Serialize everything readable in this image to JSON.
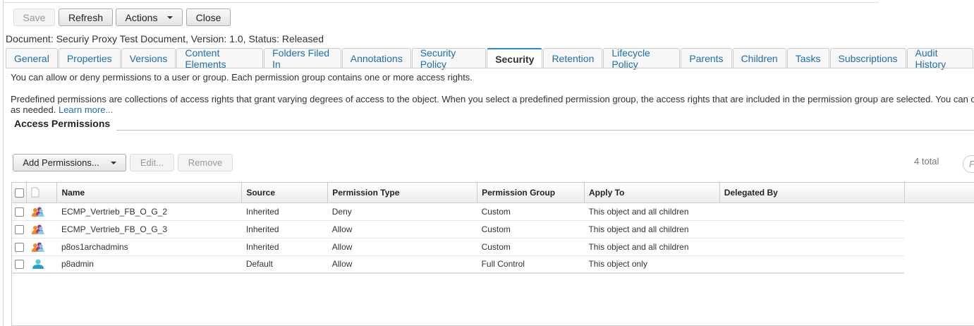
{
  "toolbar": {
    "save": "Save",
    "refresh": "Refresh",
    "actions": "Actions",
    "close": "Close"
  },
  "document_info": "Document: Securiy Proxy Test Document, Version: 1.0, Status: Released",
  "tabs": [
    "General",
    "Properties",
    "Versions",
    "Content Elements",
    "Folders Filed In",
    "Annotations",
    "Security Policy",
    "Security",
    "Retention",
    "Lifecycle Policy",
    "Parents",
    "Children",
    "Tasks",
    "Subscriptions",
    "Audit History"
  ],
  "active_tab": "Security",
  "security": {
    "intro": "You can allow or deny permissions to a user or group. Each permission group contains one or more access rights.",
    "predefined": "Predefined permissions are collections of access rights that grant varying degrees of access to the object. When you select a predefined permission group, the access rights that are included in the permission group are selected. You can c",
    "predefined_cont": "as needed.",
    "learn_more": "Learn more...",
    "section_title": "Access Permissions",
    "add_permissions": "Add Permissions...",
    "edit": "Edit...",
    "remove": "Remove",
    "total": "4 total",
    "filter_placeholder": "F",
    "columns": [
      "Name",
      "Source",
      "Permission Type",
      "Permission Group",
      "Apply To",
      "Delegated By"
    ],
    "rows": [
      {
        "icon": "group-icon",
        "name": "ECMP_Vertrieb_FB_O_G_2",
        "source": "Inherited",
        "type": "Deny",
        "group": "Custom",
        "apply": "This object and all children",
        "delegated": ""
      },
      {
        "icon": "group-icon",
        "name": "ECMP_Vertrieb_FB_O_G_3",
        "source": "Inherited",
        "type": "Allow",
        "group": "Custom",
        "apply": "This object and all children",
        "delegated": ""
      },
      {
        "icon": "group-icon",
        "name": "p8os1archadmins",
        "source": "Inherited",
        "type": "Allow",
        "group": "Custom",
        "apply": "This object and all children",
        "delegated": ""
      },
      {
        "icon": "user-icon",
        "name": "p8admin",
        "source": "Default",
        "type": "Allow",
        "group": "Full Control",
        "apply": "This object only",
        "delegated": ""
      }
    ]
  },
  "colors": {
    "accent": "#2b8ac6",
    "link": "#1f6fa8"
  }
}
